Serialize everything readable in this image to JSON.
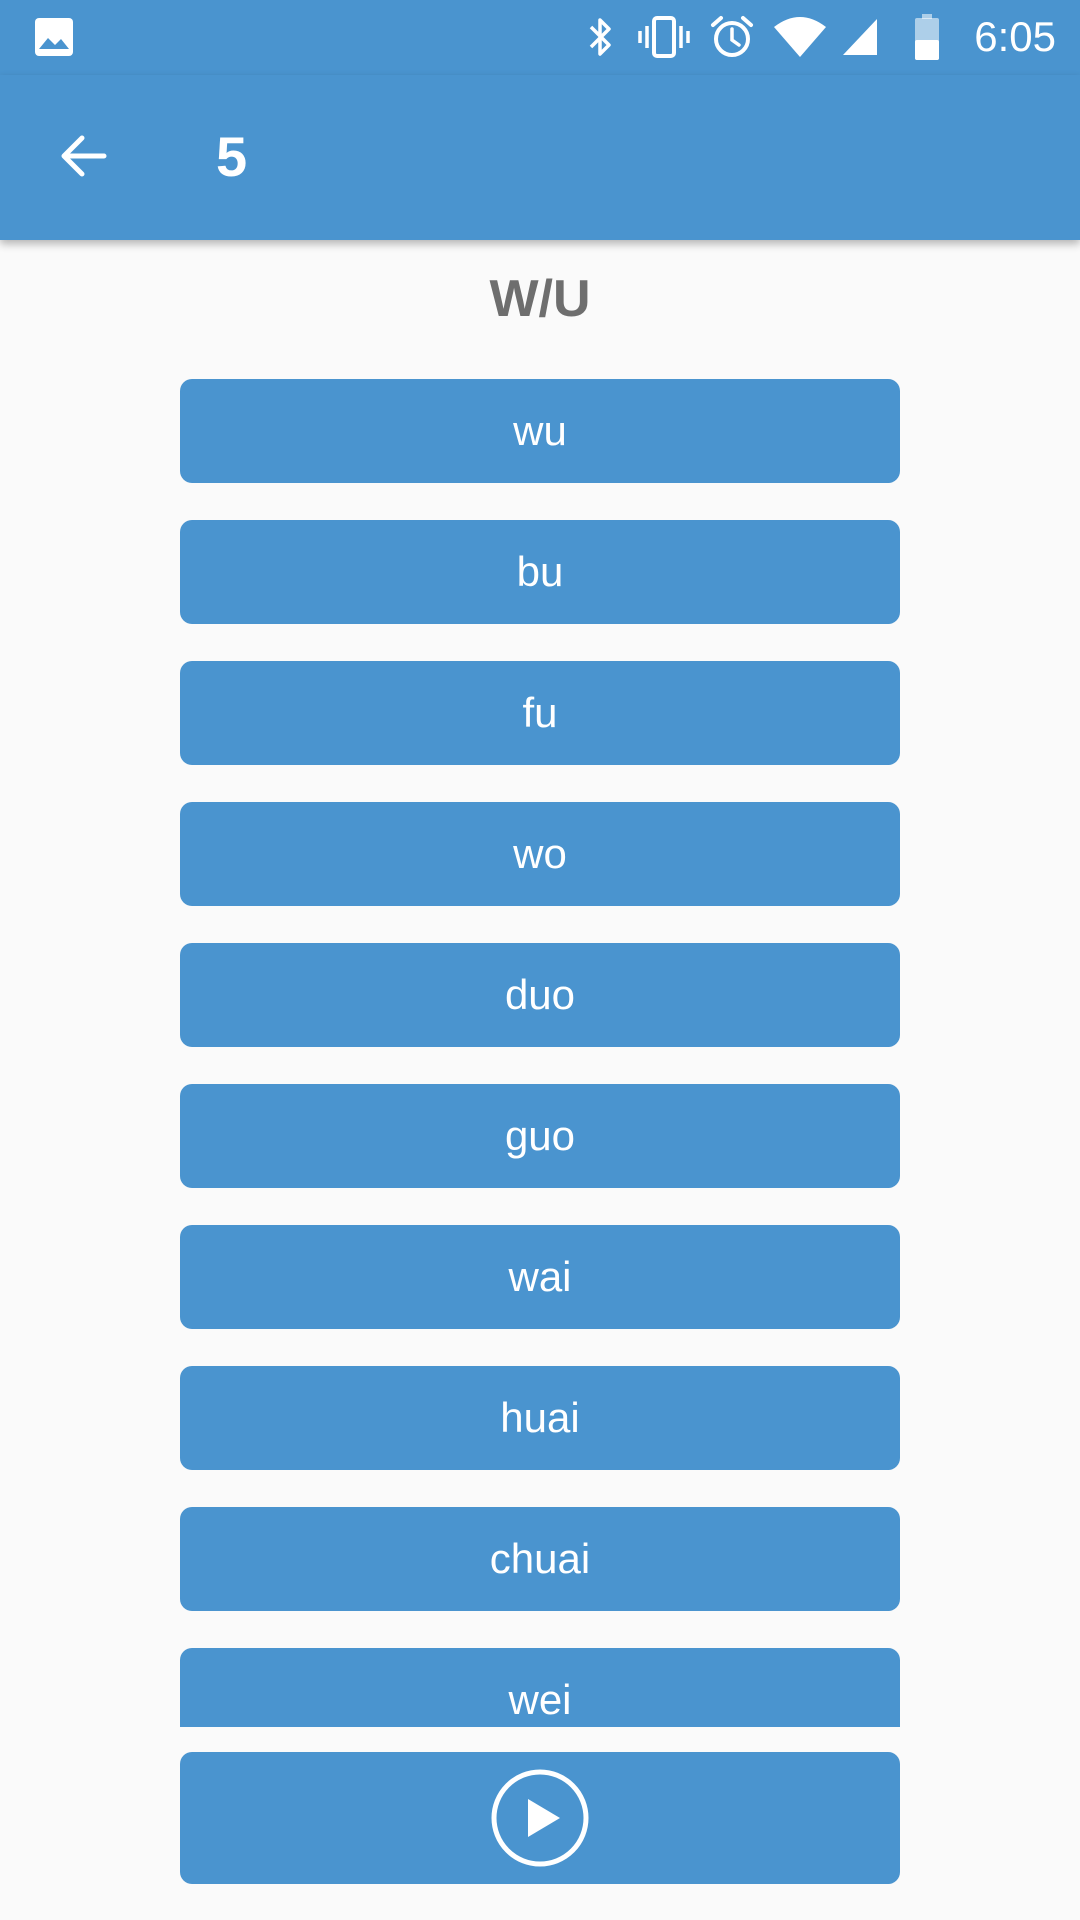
{
  "status_bar": {
    "time": "6:05",
    "icons": [
      "image-notification-icon",
      "bluetooth-icon",
      "vibrate-icon",
      "alarm-icon",
      "wifi-icon",
      "cell-signal-icon",
      "battery-icon"
    ]
  },
  "app_bar": {
    "back_icon": "arrow-left-icon",
    "title": "5"
  },
  "heading": "W/U",
  "syllables": [
    "wu",
    "bu",
    "fu",
    "wo",
    "duo",
    "guo",
    "wai",
    "huai",
    "chuai",
    "wei"
  ],
  "play_button": {
    "icon": "play-circle-icon"
  },
  "colors": {
    "primary": "#4a94cf",
    "background": "#fafafa",
    "heading_text": "#6e6e6e",
    "on_primary": "#ffffff"
  }
}
